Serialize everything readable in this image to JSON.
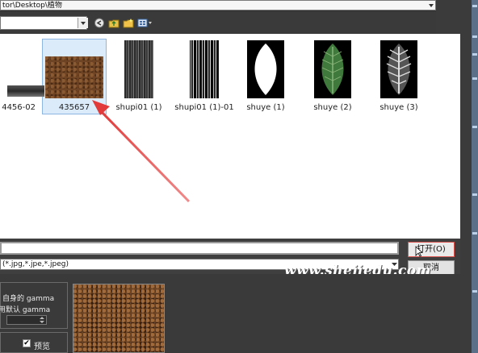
{
  "address_bar": {
    "path": "tor\\Desktop\\植物"
  },
  "files": [
    {
      "name": "4456-02",
      "kind": "strip"
    },
    {
      "name": "435657",
      "kind": "soil",
      "selected": true
    },
    {
      "name": "shupi01 (1)",
      "kind": "bark-dark"
    },
    {
      "name": "shupi01 (1)-01",
      "kind": "bark-light"
    },
    {
      "name": "shuye (1)",
      "kind": "leaf-mask"
    },
    {
      "name": "shuye (2)",
      "kind": "leaf-green"
    },
    {
      "name": "shuye (3)",
      "kind": "leaf-bw"
    }
  ],
  "filename": {
    "value": ""
  },
  "filetype": {
    "value": "(*.jpg,*.jpe,*.jpeg)"
  },
  "buttons": {
    "open": "打开(O)",
    "cancel": "取消"
  },
  "gamma": {
    "line1": "自身的 gamma",
    "line2": "使用默认 gamma"
  },
  "preview": {
    "label": "预览",
    "checked": true
  },
  "watermark": "www.shejiedu.com",
  "colors": {
    "accent_arrow": "#e23a3a",
    "selection": "#dcebfa"
  }
}
